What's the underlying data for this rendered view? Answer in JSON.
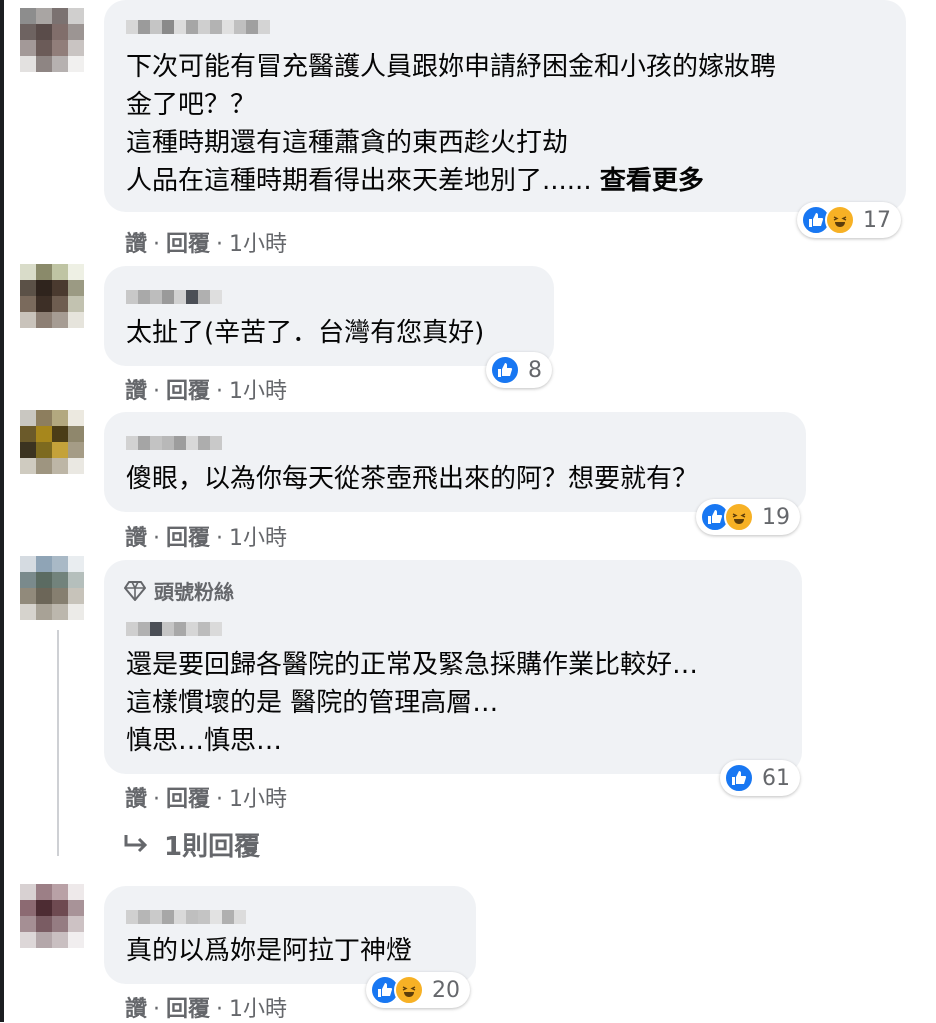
{
  "comments": [
    {
      "lines": [
        "下次可能有冒充醫護人員跟妳申請紓困金和小孩的嫁妝聘",
        "金了吧？？",
        "這種時期還有這種蕭貪的東西趁火打劫",
        "人品在這種時期看得出來天差地別了......"
      ],
      "see_more": "查看更多",
      "reaction_count": "17",
      "like_label": "讚",
      "reply_label": "回覆",
      "dot": "·",
      "time": "1小時"
    },
    {
      "lines": [
        "太扯了(辛苦了．台灣有您真好)"
      ],
      "reaction_count": "8",
      "like_label": "讚",
      "reply_label": "回覆",
      "dot": "·",
      "time": "1小時"
    },
    {
      "lines": [
        "傻眼，以為你每天從茶壺飛出來的阿？想要就有？"
      ],
      "reaction_count": "19",
      "like_label": "讚",
      "reply_label": "回覆",
      "dot": "·",
      "time": "1小時"
    },
    {
      "badge": "頭號粉絲",
      "lines": [
        "還是要回歸各醫院的正常及緊急採購作業比較好…",
        "這樣慣壞的是 醫院的管理高層…",
        "慎思…慎思…"
      ],
      "reaction_count": "61",
      "like_label": "讚",
      "reply_label": "回覆",
      "dot": "·",
      "time": "1小時"
    },
    {
      "lines": [
        "真的以爲妳是阿拉丁神燈"
      ],
      "reaction_count": "20",
      "like_label": "讚",
      "reply_label": "回覆",
      "dot": "·",
      "time": "1小時"
    }
  ],
  "replies_link": "1則回覆",
  "icons": {
    "like": "thumbs-up-icon",
    "haha": "laughing-face-icon",
    "badge": "diamond-icon",
    "reply_arrow": "reply-arrow-icon"
  },
  "colors": {
    "bubble": "#f0f2f5",
    "like_blue": "#1877f2",
    "haha_yellow": "#f7b125",
    "secondary_text": "#65676b"
  }
}
